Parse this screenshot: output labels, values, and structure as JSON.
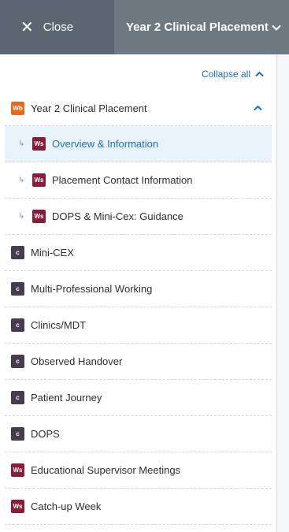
{
  "topbar": {
    "close_label": "Close",
    "title": "Year 2 Clinical Placement"
  },
  "panel": {
    "collapse_all_label": "Collapse all",
    "items": [
      {
        "badge": "Wb",
        "label": "Year 2 Clinical Placement"
      },
      {
        "badge": "Ws",
        "label": "Overview & Information"
      },
      {
        "badge": "Ws",
        "label": "Placement Contact Information"
      },
      {
        "badge": "Ws",
        "label": "DOPS & Mini-Cex: Guidance"
      },
      {
        "badge": "c",
        "label": "Mini-CEX"
      },
      {
        "badge": "c",
        "label": "Multi-Professional Working"
      },
      {
        "badge": "c",
        "label": "Clinics/MDT"
      },
      {
        "badge": "c",
        "label": "Observed Handover"
      },
      {
        "badge": "c",
        "label": "Patient Journey"
      },
      {
        "badge": "c",
        "label": "DOPS"
      },
      {
        "badge": "Ws",
        "label": "Educational Supervisor Meetings"
      },
      {
        "badge": "Ws",
        "label": "Catch-up Week"
      }
    ]
  },
  "colors": {
    "close_bg": "#5c6670",
    "title_bg": "#6e7982",
    "accent": "#1f6fb2",
    "wb_badge": "#e66a1d",
    "ws_badge": "#8a1c3a",
    "c_badge": "#473c4f",
    "selected_bg": "#e8f3fb"
  }
}
